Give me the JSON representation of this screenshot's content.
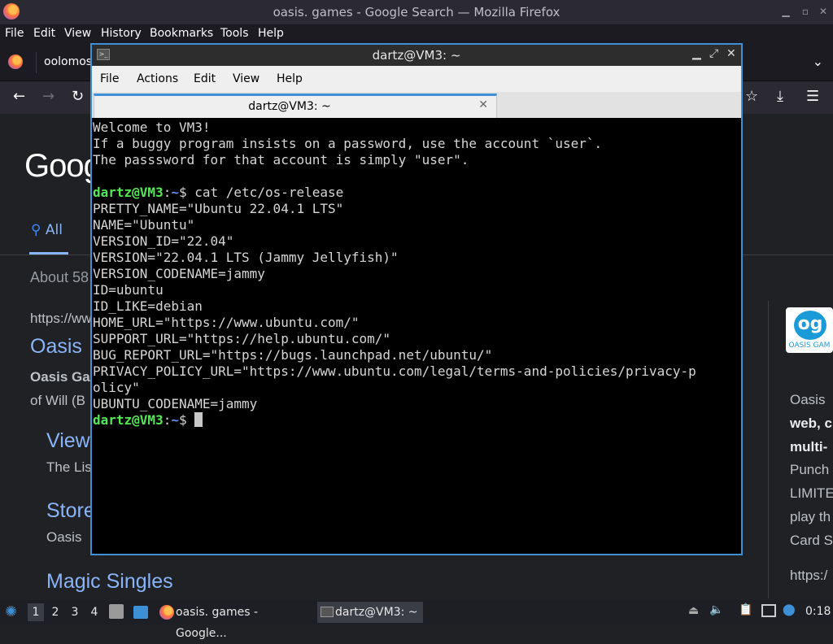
{
  "firefox": {
    "window_title": "oasis. games - Google Search — Mozilla Firefox",
    "menu": [
      "File",
      "Edit",
      "View",
      "History",
      "Bookmarks",
      "Tools",
      "Help"
    ],
    "tab_label": "oolomos"
  },
  "google": {
    "logo": "Goog",
    "all_tab": "All",
    "results_count": "About 58",
    "results": [
      {
        "text": "https://ww"
      },
      {
        "text": "Oasis"
      },
      {
        "text": "Oasis Ga"
      },
      {
        "text": "of Will (B"
      },
      {
        "text": "View"
      },
      {
        "text": "The Lis"
      },
      {
        "text": "Store"
      },
      {
        "text": "Oasis"
      },
      {
        "text": "Magic Singles"
      }
    ],
    "knowledge_panel": {
      "logo_text": "og",
      "logo_caption": "OASIS GAM",
      "lines": [
        "Oasis",
        "web, c",
        "multi-",
        "Punch",
        "LIMITE",
        "play th",
        "Card S",
        "https:/"
      ]
    }
  },
  "terminal": {
    "title": "dartz@VM3: ~",
    "menu": [
      "File",
      "Actions",
      "Edit",
      "View",
      "Help"
    ],
    "tab_label": "dartz@VM3: ~",
    "tab_close": "✕",
    "welcome": [
      "Welcome to VM3!",
      "If a buggy program insists on a password, use the account `user`.",
      "The passsword for that account is simply \"user\"."
    ],
    "prompt_user": "dartz@VM3",
    "prompt_sep": ":",
    "prompt_dir": "~",
    "prompt_end": "$ ",
    "command": "cat /etc/os-release",
    "output": [
      "PRETTY_NAME=\"Ubuntu 22.04.1 LTS\"",
      "NAME=\"Ubuntu\"",
      "VERSION_ID=\"22.04\"",
      "VERSION=\"22.04.1 LTS (Jammy Jellyfish)\"",
      "VERSION_CODENAME=jammy",
      "ID=ubuntu",
      "ID_LIKE=debian",
      "HOME_URL=\"https://www.ubuntu.com/\"",
      "SUPPORT_URL=\"https://help.ubuntu.com/\"",
      "BUG_REPORT_URL=\"https://bugs.launchpad.net/ubuntu/\"",
      "PRIVACY_POLICY_URL=\"https://www.ubuntu.com/legal/terms-and-policies/privacy-p",
      "olicy\"",
      "UBUNTU_CODENAME=jammy"
    ]
  },
  "taskbar": {
    "workspaces": [
      "1",
      "2",
      "3",
      "4"
    ],
    "active_workspace": "1",
    "tasks": [
      {
        "label": "oasis. games - Google...",
        "icon": "firefox-icon"
      },
      {
        "label": "dartz@VM3: ~",
        "icon": "terminal-icon"
      }
    ],
    "clock": "0:18"
  },
  "colors": {
    "prompt_user": "#54e854",
    "prompt_dir": "#6b8ff0",
    "window_border": "#3d8fd6",
    "google_link": "#8ab4f8"
  }
}
